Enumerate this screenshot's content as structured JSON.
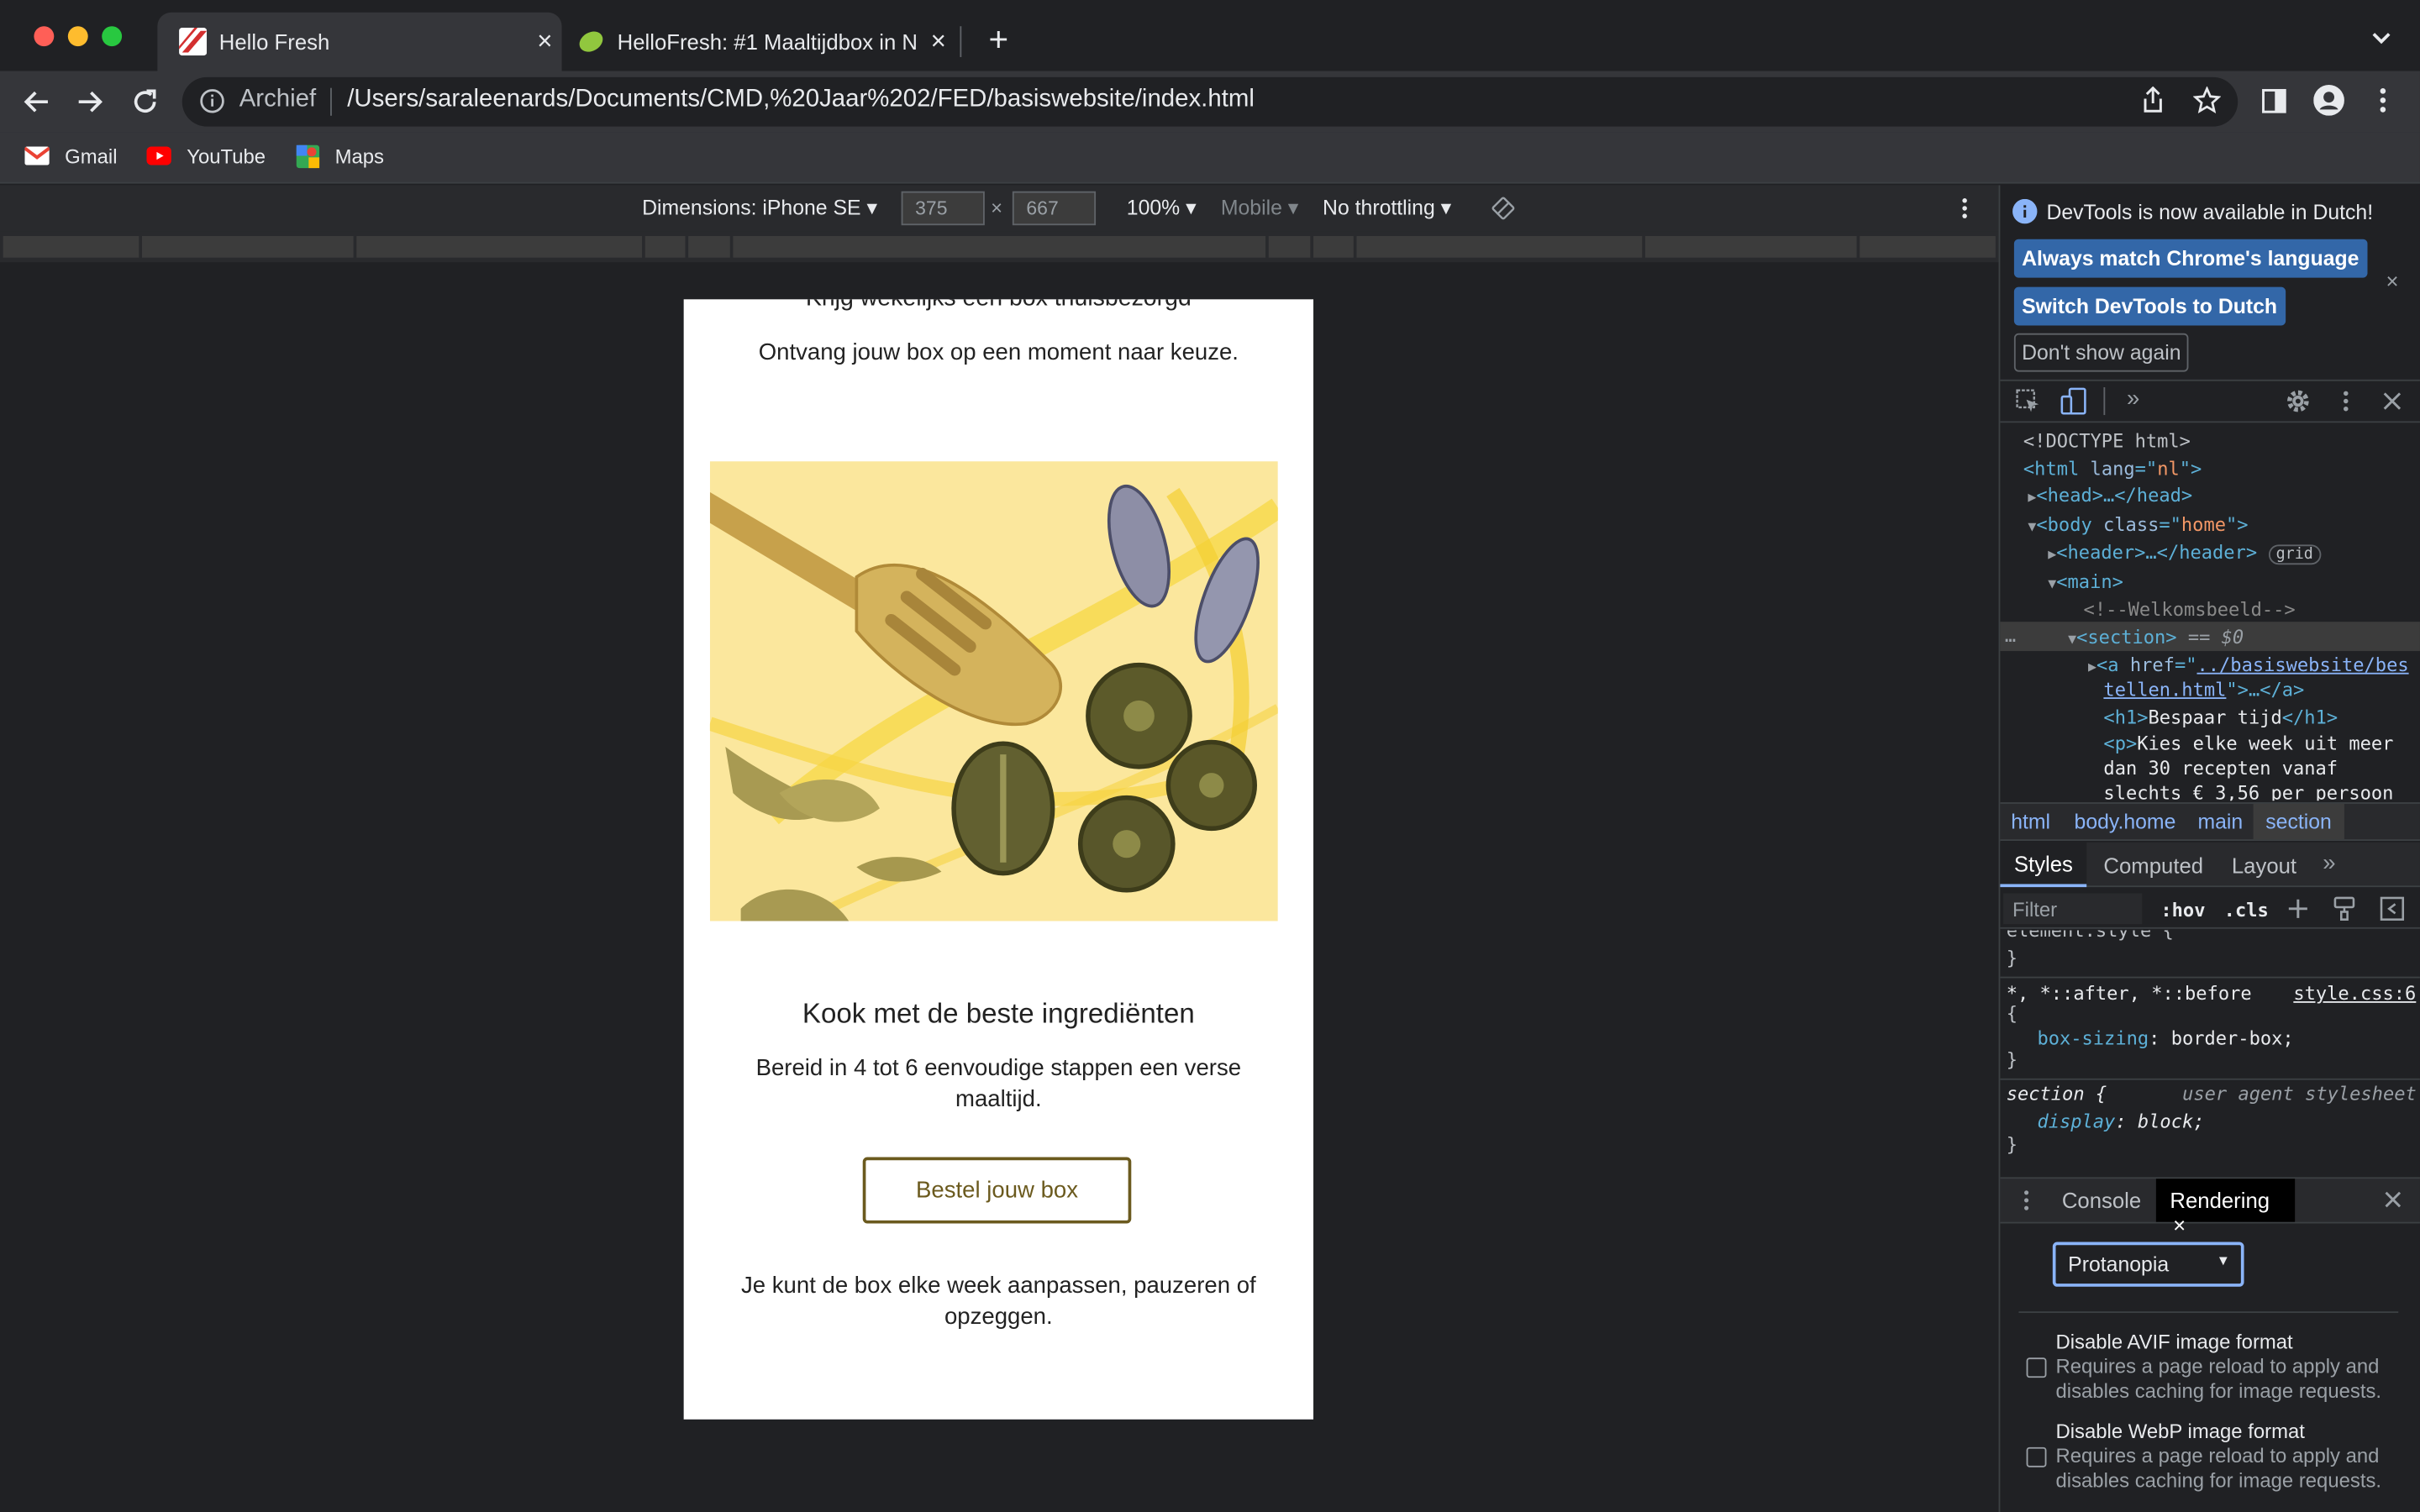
{
  "tabs": [
    {
      "title": "Hello Fresh",
      "close": "×"
    },
    {
      "title": "HelloFresh: #1 Maaltijdbox in N",
      "close": "×"
    }
  ],
  "new_tab": "+",
  "address": {
    "security_label": "Archief",
    "url": "/Users/saraleenards/Documents/CMD,%20Jaar%202/FED/basiswebsite/index.html"
  },
  "bookmarks": [
    "Gmail",
    "YouTube",
    "Maps"
  ],
  "device_toolbar": {
    "dimensions": "Dimensions: iPhone SE",
    "width": "375",
    "x": "×",
    "height": "667",
    "zoom": "100%",
    "mode": "Mobile",
    "throttle": "No throttling"
  },
  "page": {
    "top_heading": "Krijg wekelijks een box thuisbezorgd",
    "top_text": "Ontvang jouw box op een moment naar keuze.",
    "heading": "Kook met de beste ingrediënten",
    "text": "Bereid in 4 tot 6 eenvoudige stappen een verse maaltijd.",
    "cta": "Bestel jouw box",
    "footer_text": "Je kunt de box elke week aanpassen, pauzeren of opzeggen."
  },
  "devtools": {
    "banner": "DevTools is now available in Dutch!",
    "btn_match": "Always match Chrome's language",
    "btn_switch": "Switch DevTools to Dutch",
    "btn_dont": "Don't show again",
    "dom": {
      "l1": "<!DOCTYPE html>",
      "l2a": "<html ",
      "l2b": "lang",
      "l2c": "=\"",
      "l2d": "nl",
      "l2e": "\">",
      "l3": "<head>…</head>",
      "l4a": "<body ",
      "l4b": "class",
      "l4c": "=\"",
      "l4d": "home",
      "l4e": "\">",
      "l5": "<header>…</header>",
      "l5badge": "grid",
      "l6": "<main>",
      "l7": "<!--Welkomsbeeld-->",
      "l8": "<section>",
      "l8b": " == $0",
      "l9a": "<a ",
      "l9b": "href",
      "l9c": "=\"",
      "l9d": "../basiswebsite/bes",
      "l10a": "tellen.html",
      "l10b": "\">…</a>",
      "l11a": "<h1>",
      "l11b": "Bespaar tijd",
      "l11c": "</h1>",
      "l12a": "<p>",
      "l12b": "Kies elke week uit meer",
      "l13": "dan 30 recepten vanaf",
      "l14": "slechts € 3,56 per persoon"
    },
    "breadcrumbs": [
      "html",
      "body.home",
      "main",
      "section"
    ],
    "style_tabs": [
      "Styles",
      "Computed",
      "Layout"
    ],
    "filter_placeholder": "Filter",
    "hov": ":hov",
    "cls": ".cls",
    "css": {
      "r0": "element.style {",
      "close": "}",
      "r1sel": "*, *::after, *::before",
      "r1src": "style.css:6",
      "open": "{",
      "r1prop": "box-sizing",
      "r1val": "border-box;",
      "r2sel": "section {",
      "r2src": "user agent stylesheet",
      "r2prop": "display",
      "r2val": "block;"
    },
    "drawer_tabs": [
      "Console",
      "Rendering"
    ],
    "drawer_close": "×",
    "select_value": "Protanopia",
    "opts": [
      {
        "title": "Disable AVIF image format",
        "desc": "Requires a page reload to apply and disables caching for image requests."
      },
      {
        "title": "Disable WebP image format",
        "desc": "Requires a page reload to apply and disables caching for image requests."
      }
    ]
  },
  "colors": {
    "accent": "#8ab4f8",
    "devtools_button": "#3367a8",
    "cta_border": "#6b5a1e"
  }
}
